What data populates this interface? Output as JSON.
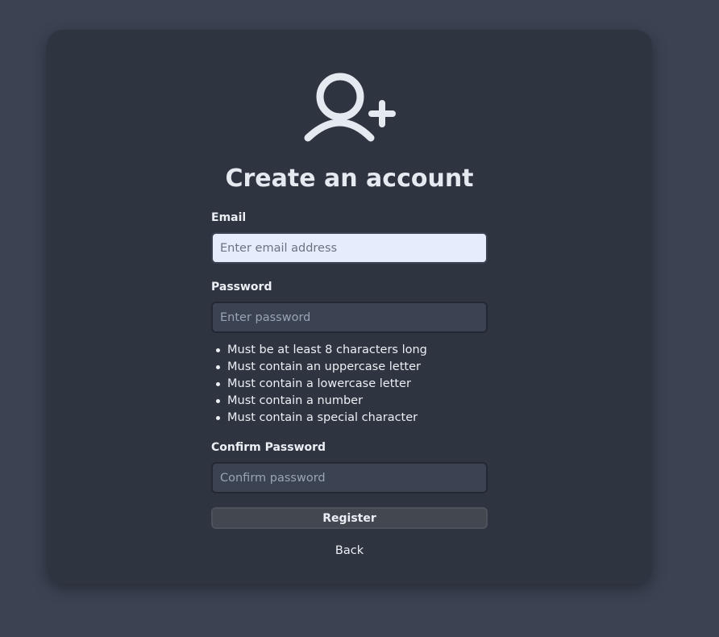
{
  "header": {
    "icon": "user-plus-icon",
    "title": "Create an account"
  },
  "form": {
    "email": {
      "label": "Email",
      "value": "",
      "placeholder": "Enter email address"
    },
    "password": {
      "label": "Password",
      "value": "",
      "placeholder": "Enter password",
      "requirements": [
        "Must be at least 8 characters long",
        "Must contain an uppercase letter",
        "Must contain a lowercase letter",
        "Must contain a number",
        "Must contain a special character"
      ]
    },
    "confirm_password": {
      "label": "Confirm Password",
      "value": "",
      "placeholder": "Confirm password"
    },
    "register_label": "Register",
    "back_label": "Back"
  },
  "colors": {
    "page_background": "#3b4252",
    "card_background": "#2e3440",
    "text": "#eceff4",
    "email_input_background": "#e5ecfb",
    "dark_input_background": "#3b4252",
    "button_background": "#434750"
  }
}
